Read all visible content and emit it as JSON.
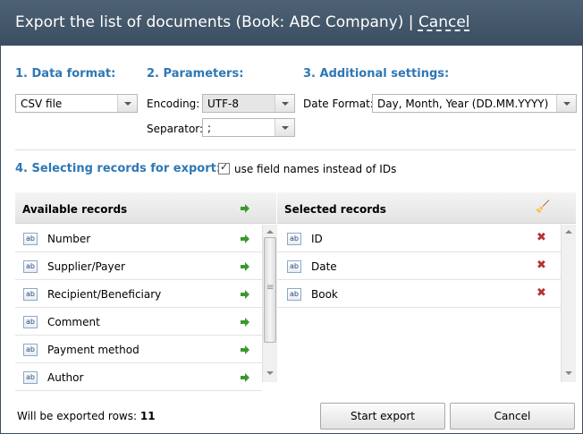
{
  "window": {
    "title": "Export the list of documents (Book: ABC Company) | ",
    "cancel_link": "Cancel"
  },
  "data_format": {
    "heading": "1. Data format:",
    "value": "CSV file"
  },
  "parameters": {
    "heading": "2. Parameters:",
    "encoding_label": "Encoding:",
    "encoding_value": "UTF-8",
    "separator_label": "Separator:",
    "separator_value": ";"
  },
  "additional": {
    "heading": "3. Additional settings:",
    "date_format_label": "Date Format:",
    "date_format_value": "Day, Month, Year (DD.MM.YYYY)"
  },
  "records": {
    "heading": "4. Selecting records for export:",
    "use_field_names_label": "use field names instead of IDs",
    "use_field_names_checked": true,
    "available_header": "Available records",
    "selected_header": "Selected records",
    "field_icon_text": "ab",
    "available": [
      {
        "label": "Number"
      },
      {
        "label": "Supplier/Payer"
      },
      {
        "label": "Recipient/Beneficiary"
      },
      {
        "label": "Comment"
      },
      {
        "label": "Payment method"
      },
      {
        "label": "Author"
      }
    ],
    "selected": [
      {
        "label": "ID"
      },
      {
        "label": "Date"
      },
      {
        "label": "Book"
      }
    ]
  },
  "footer": {
    "rows_label": "Will be exported rows:",
    "rows_count": "11",
    "start_button": "Start export",
    "cancel_button": "Cancel"
  },
  "colors": {
    "accent": "#2d78b5",
    "titlebar": "#3b4e61",
    "add_arrow": "#3a9a2c",
    "remove_x": "#b23333"
  }
}
